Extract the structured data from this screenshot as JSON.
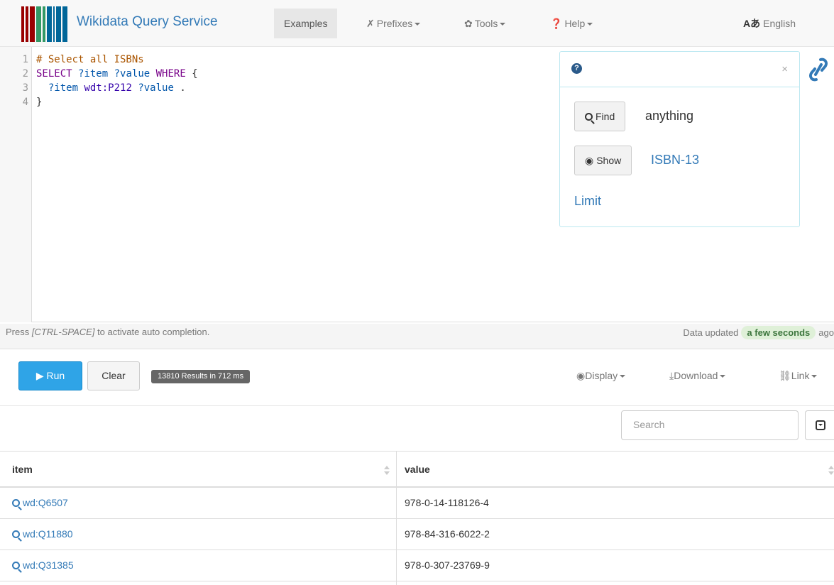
{
  "navbar": {
    "brand": "Wikidata Query Service",
    "examples": "Examples",
    "prefixes": "Prefixes",
    "tools": "Tools",
    "help": "Help",
    "language_icon": "Aあ",
    "language": "English"
  },
  "editor": {
    "lines": [
      {
        "n": "1"
      },
      {
        "n": "2"
      },
      {
        "n": "3"
      },
      {
        "n": "4"
      }
    ],
    "line1": "# Select all ISBNs",
    "line2_kw1": "SELECT",
    "line2_v1": "?item",
    "line2_v2": "?value",
    "line2_kw2": "WHERE",
    "line2_brace": "{",
    "line3_v1": "?item",
    "line3_atom": "wdt:P212",
    "line3_v2": "?value",
    "line3_dot": ".",
    "line4": "}"
  },
  "help_popover": {
    "find_button": "Find",
    "find_text": "anything",
    "show_button": "Show",
    "show_link": "ISBN-13",
    "limit_link": "Limit",
    "close": "×"
  },
  "status": {
    "hint_prefix": "Press ",
    "hint_key": "[CTRL-SPACE]",
    "hint_suffix": " to activate auto completion.",
    "updated_prefix": "Data updated",
    "updated_badge": "a few seconds",
    "updated_suffix": "ago"
  },
  "toolbar": {
    "run": "Run",
    "clear": "Clear",
    "results_badge": "13810 Results in 712 ms",
    "display": "Display",
    "download": "Download",
    "link": "Link"
  },
  "search": {
    "placeholder": "Search"
  },
  "table": {
    "headers": [
      "item",
      "value"
    ],
    "rows": [
      {
        "item": "wd:Q6507",
        "value": "978-0-14-118126-4"
      },
      {
        "item": "wd:Q11880",
        "value": "978-84-316-6022-2"
      },
      {
        "item": "wd:Q31385",
        "value": "978-0-307-23769-9"
      }
    ]
  },
  "colors": {
    "brand_blue": "#337ab7",
    "run_button": "#2fa4e7",
    "badge_green": "#dff0d8"
  }
}
